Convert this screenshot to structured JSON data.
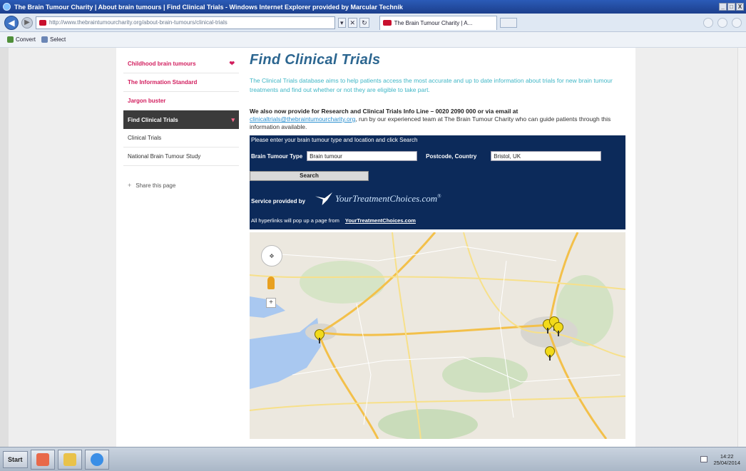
{
  "window": {
    "title": "The Brain Tumour Charity | About brain tumours | Find Clinical Trials - Windows Internet Explorer provided by Marcular Technik",
    "controls": [
      "_",
      "□",
      "X"
    ]
  },
  "browser": {
    "url": "http://www.thebraintumourcharity.org/about-brain-tumours/clinical-trials",
    "tab_title": "The Brain Tumour Charity | A...",
    "addr_tools": [
      "▾",
      "✕",
      "↻"
    ],
    "command_bar": {
      "convert": "Convert",
      "select": "Select"
    }
  },
  "sidebar": {
    "items": [
      {
        "label": "Childhood brain tumours",
        "chevron": "❤"
      },
      {
        "label": "The Information Standard"
      },
      {
        "label": "Jargon buster"
      },
      {
        "label": "Find Clinical Trials",
        "chevron": "▾"
      },
      {
        "label": "Clinical Trials"
      },
      {
        "label": "National Brain Tumour Study"
      }
    ],
    "share_label": "Share this page",
    "share_icon": "+"
  },
  "main": {
    "title": "Find Clinical Trials",
    "lead": "The Clinical Trials database aims to help patients access the most accurate and up to date information about trials for new brain tumour treatments and find out whether or not they are eligible to take part.",
    "para_strong": "We also now provide for Research and Clinical Trials Info Line – 0020 2090 000 or via email at",
    "para_email": "clinicaltrials@thebraintumourcharity.org",
    "para_rest": ", run by our experienced team at The Brain Tumour Charity who can guide patients through this information available."
  },
  "search": {
    "instructions": "Please enter your brain tumour type and location and click Search",
    "type_label": "Brain Tumour Type",
    "type_value": "Brain tumour",
    "postcode_label": "Postcode, Country",
    "postcode_value": "Bristol, UK",
    "button": "Search",
    "provided_by": "Service provided by",
    "logo_text": "YourTreatmentChoices.com",
    "logo_mark": "®",
    "hyperlinks_text": "All hyperlinks will pop up a page from",
    "hyperlinks_link": "YourTreatmentChoices.com"
  },
  "map": {
    "pan_icon": "✥",
    "zoom_in": "+",
    "pins": 5
  },
  "taskbar": {
    "start": "Start",
    "time": "14:22",
    "date": "25/04/2014"
  }
}
